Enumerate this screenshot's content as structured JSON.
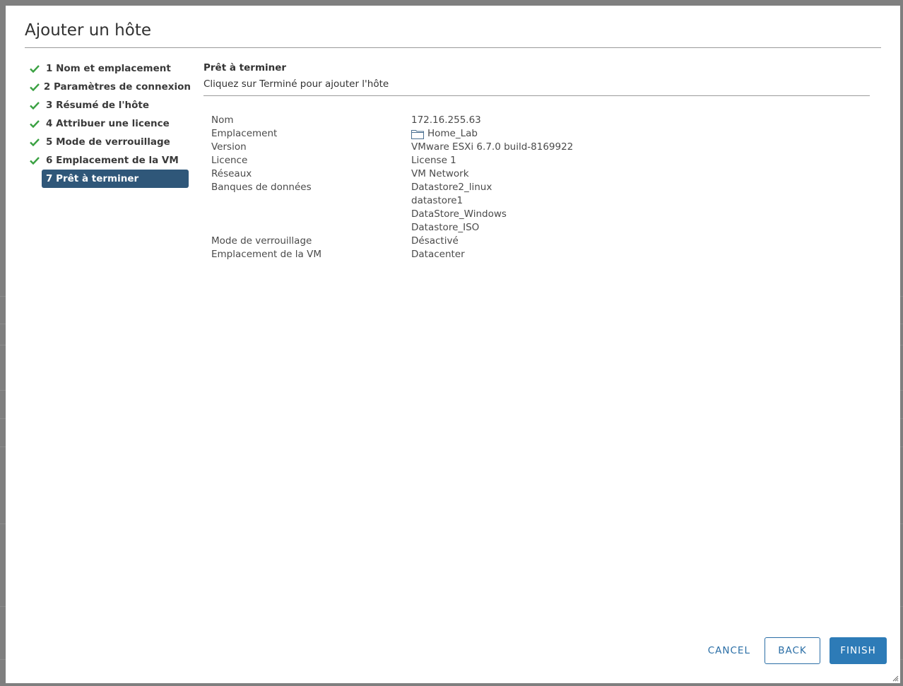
{
  "dialog": {
    "title": "Ajouter un hôte"
  },
  "steps": [
    {
      "label": "1 Nom et emplacement",
      "completed": true
    },
    {
      "label": "2 Paramètres de connexion",
      "completed": true
    },
    {
      "label": "3 Résumé de l'hôte",
      "completed": true
    },
    {
      "label": "4 Attribuer une licence",
      "completed": true
    },
    {
      "label": "5 Mode de verrouillage",
      "completed": true
    },
    {
      "label": "6 Emplacement de la VM",
      "completed": true
    },
    {
      "label": "7 Prêt à terminer",
      "completed": false,
      "active": true
    }
  ],
  "content": {
    "heading": "Prêt à terminer",
    "subtitle": "Cliquez sur Terminé pour ajouter l'hôte"
  },
  "summary": {
    "nom": {
      "label": "Nom",
      "value": "172.16.255.63"
    },
    "emplacement": {
      "label": "Emplacement",
      "value": "Home_Lab",
      "icon": "folder-icon"
    },
    "version": {
      "label": "Version",
      "value": "VMware ESXi 6.7.0 build-8169922"
    },
    "licence": {
      "label": "Licence",
      "value": "License 1"
    },
    "reseaux": {
      "label": "Réseaux",
      "value": "VM Network"
    },
    "banques": {
      "label": "Banques de données",
      "values": [
        "Datastore2_linux",
        "datastore1",
        "DataStore_Windows",
        "Datastore_ISO"
      ]
    },
    "mode": {
      "label": "Mode de verrouillage",
      "value": "Désactivé"
    },
    "vm_location": {
      "label": "Emplacement de la VM",
      "value": "Datacenter"
    }
  },
  "footer": {
    "cancel": "CANCEL",
    "back": "BACK",
    "finish": "FINISH"
  },
  "colors": {
    "active_step_bg": "#2f5779",
    "check_green": "#3aa142",
    "primary": "#2d7bb7"
  }
}
